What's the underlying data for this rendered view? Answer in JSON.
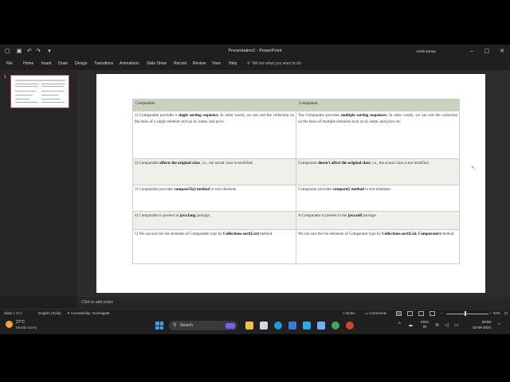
{
  "window": {
    "title": "Presentation1  -  PowerPoint",
    "user": "Anish kumar"
  },
  "ribbon": {
    "tabs": [
      "File",
      "Home",
      "Insert",
      "Draw",
      "Design",
      "Transitions",
      "Animations",
      "Slide Show",
      "Record",
      "Review",
      "View",
      "Help"
    ],
    "tell_me": "Tell me what you want to do"
  },
  "thumbnails": {
    "slide_number": "1"
  },
  "table": {
    "headers": [
      "Comparable",
      "Comparator"
    ],
    "rows": [
      {
        "left": [
          {
            "t": "1) Comparable provides a "
          },
          {
            "t": "single sorting sequence.",
            "b": true
          },
          {
            "t": " In other words, we can sort the collection on the basis of a single element such as id, name, and price."
          }
        ],
        "right": [
          {
            "t": "The Comparator provides "
          },
          {
            "t": "multiple sorting sequences.",
            "b": true
          },
          {
            "t": " In other words, we can sort the collection on the basis of multiple elements such as id, name, and price etc."
          }
        ]
      },
      {
        "left": [
          {
            "t": "2) Comparable "
          },
          {
            "t": "affects the original class",
            "b": true
          },
          {
            "t": ", i.e., the actual class is modified."
          }
        ],
        "right": [
          {
            "t": "Comparator "
          },
          {
            "t": "doesn't affect the original class",
            "b": true
          },
          {
            "t": ", i.e., the actual class is not modified."
          }
        ]
      },
      {
        "left": [
          {
            "t": "3) Comparable provides "
          },
          {
            "t": "compareTo() method",
            "b": true
          },
          {
            "t": " to sort elements."
          }
        ],
        "right": [
          {
            "t": "Comparator provides "
          },
          {
            "t": "compare() method",
            "b": true
          },
          {
            "t": " to sort elements."
          }
        ]
      },
      {
        "left": [
          {
            "t": "4) Comparable is present in "
          },
          {
            "t": "java.lang",
            "b": true
          },
          {
            "t": " package."
          }
        ],
        "right": [
          {
            "t": "A Comparator is present in the "
          },
          {
            "t": "java.util",
            "b": true
          },
          {
            "t": " package."
          }
        ]
      },
      {
        "left": [
          {
            "t": "5) We can sort the list elements of Comparable type by "
          },
          {
            "t": "Collections.sort(List)",
            "b": true
          },
          {
            "t": " method."
          }
        ],
        "right": [
          {
            "t": "We can sort the list elements of Comparator type by "
          },
          {
            "t": "Collections.sort(List, Comparator)",
            "b": true
          },
          {
            "t": " method."
          }
        ]
      }
    ]
  },
  "notes": {
    "placeholder": "Click to add notes"
  },
  "status": {
    "slide": "Slide 1 of 1",
    "language": "English (India)",
    "accessibility": "Accessibility: Investigate",
    "notes_btn": "Notes",
    "comments_btn": "Comments",
    "zoom": "92%"
  },
  "taskbar": {
    "temp": "37°C",
    "weather": "Mostly sunny",
    "search": "Search",
    "lang_top": "ENG",
    "lang_bottom": "IN",
    "time": "09:58",
    "date": "02-06-2024"
  },
  "colors": {
    "header_fill": "#c9d2bf",
    "row_shade": "#eef1ea",
    "thumb_border": "#c0504d"
  }
}
